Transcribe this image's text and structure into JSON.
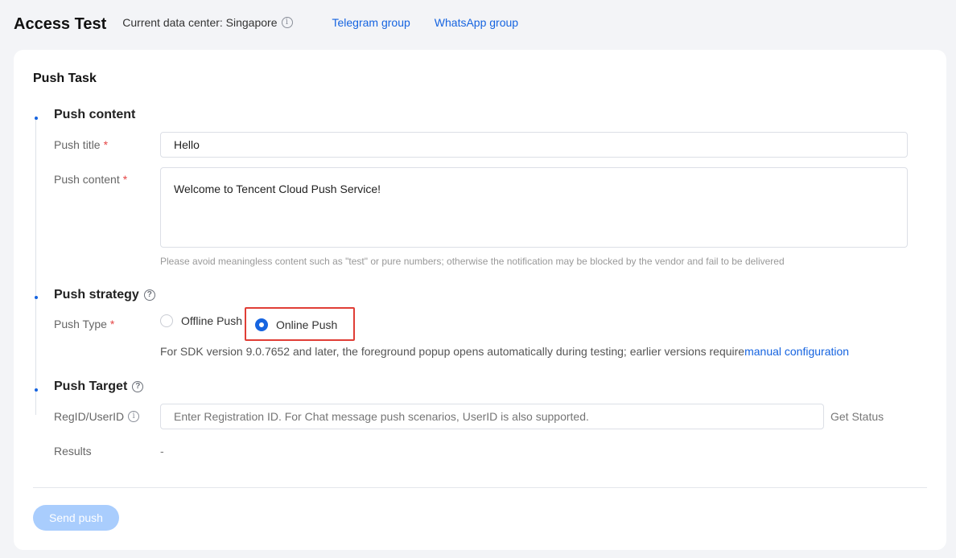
{
  "header": {
    "title": "Access Test",
    "data_center": "Current data center: Singapore",
    "links": [
      "Telegram group",
      "WhatsApp group"
    ]
  },
  "card": {
    "title": "Push Task",
    "sections": {
      "content": {
        "title": "Push content",
        "push_title_label": "Push title",
        "push_title_value": "Hello",
        "push_content_label": "Push content",
        "push_content_value": "Welcome to Tencent Cloud Push Service!",
        "hint": "Please avoid meaningless content such as \"test\" or pure numbers; otherwise the notification may be blocked by the vendor and fail to be delivered"
      },
      "strategy": {
        "title": "Push strategy",
        "push_type_label": "Push Type",
        "options": [
          "Offline Push",
          "Online Push"
        ],
        "selected": "Online Push",
        "note": "For SDK version 9.0.7652 and later, the foreground popup opens automatically during testing; earlier versions require",
        "note_link": "manual configuration"
      },
      "target": {
        "title": "Push Target",
        "regid_label": "RegID/UserID",
        "regid_placeholder": "Enter Registration ID. For Chat message push scenarios, UserID is also supported.",
        "get_status": "Get Status",
        "results_label": "Results",
        "results_value": "-"
      }
    },
    "send_button": "Send push"
  },
  "colors": {
    "accent": "#1664e0",
    "required": "#e54545",
    "highlight_border": "#e03e36",
    "button_disabled": "#a9cdfd"
  },
  "icons": [
    "info-icon",
    "help-icon",
    "radio-button"
  ]
}
